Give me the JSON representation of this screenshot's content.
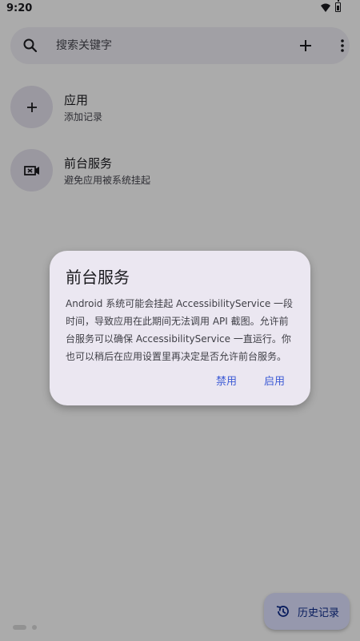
{
  "status_bar": {
    "time": "9:20"
  },
  "search": {
    "placeholder": "搜索关键字"
  },
  "list": [
    {
      "title": "应用",
      "subtitle": "添加记录",
      "icon": "add-icon"
    },
    {
      "title": "前台服务",
      "subtitle": "避免应用被系统挂起",
      "icon": "video-record-icon"
    }
  ],
  "fab": {
    "label": "历史记录",
    "icon": "history-icon"
  },
  "dialog": {
    "title": "前台服务",
    "body": "Android 系统可能会挂起 AccessibilityService 一段时间，导致应用在此期间无法调用 API 截图。允许前台服务可以确保 AccessibilityService 一直运行。你也可以稍后在应用设置里再决定是否允许前台服务。",
    "disable_label": "禁用",
    "enable_label": "启用"
  },
  "colors": {
    "accent": "#3d5bd5",
    "fab_bg": "#dde1ff",
    "dialog_bg": "#ebe7f1",
    "scrim": "rgba(0,0,0,0.32)"
  }
}
